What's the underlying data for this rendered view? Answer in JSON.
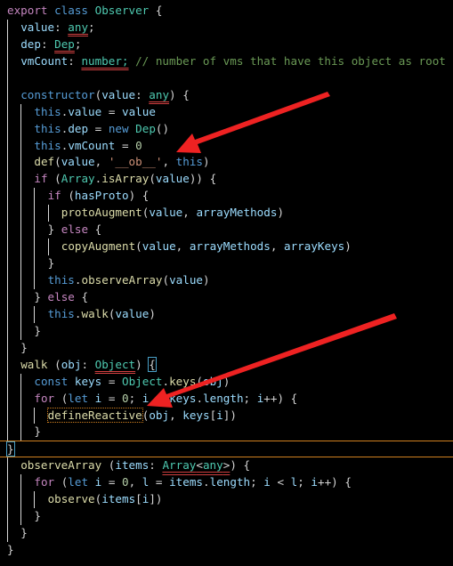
{
  "editor": {
    "theme_colors": {
      "background": "#000000",
      "keyword": "#c586c0",
      "storage": "#569cd6",
      "type": "#4ec9b0",
      "variable": "#9cdcfe",
      "function": "#dcdcaa",
      "string": "#ce9178",
      "comment": "#6a9955",
      "number": "#b5cea8",
      "annotation_arrow": "#ee2222"
    },
    "lines": [
      {
        "indent": 0,
        "tokens": [
          [
            "export",
            "kw"
          ],
          [
            " ",
            "p"
          ],
          [
            "class",
            "st"
          ],
          [
            " ",
            "p"
          ],
          [
            "Observer",
            "ty"
          ],
          [
            " {",
            "p"
          ]
        ]
      },
      {
        "indent": 1,
        "tokens": [
          [
            "value",
            "va"
          ],
          [
            ": ",
            "p"
          ],
          [
            "any",
            "ty err"
          ],
          [
            ";",
            "p"
          ]
        ]
      },
      {
        "indent": 1,
        "tokens": [
          [
            "dep",
            "va"
          ],
          [
            ": ",
            "p"
          ],
          [
            "Dep",
            "ty err"
          ],
          [
            ";",
            "p"
          ]
        ]
      },
      {
        "indent": 1,
        "tokens": [
          [
            "vmCount",
            "va"
          ],
          [
            ": ",
            "p"
          ],
          [
            "number;",
            "ty err"
          ],
          [
            " // number of vms that have this object as root",
            "cm"
          ]
        ]
      },
      {
        "indent": 1,
        "tokens": []
      },
      {
        "indent": 1,
        "tokens": [
          [
            "constructor",
            "st"
          ],
          [
            "(",
            "p"
          ],
          [
            "value",
            "va"
          ],
          [
            ": ",
            "p"
          ],
          [
            "any",
            "ty err"
          ],
          [
            ") {",
            "p"
          ]
        ]
      },
      {
        "indent": 2,
        "tokens": [
          [
            "this",
            "st"
          ],
          [
            ".",
            "p"
          ],
          [
            "value",
            "va"
          ],
          [
            " = ",
            "p"
          ],
          [
            "value",
            "va"
          ]
        ]
      },
      {
        "indent": 2,
        "tokens": [
          [
            "this",
            "st"
          ],
          [
            ".",
            "p"
          ],
          [
            "dep",
            "va"
          ],
          [
            " = ",
            "p"
          ],
          [
            "new",
            "st"
          ],
          [
            " ",
            "p"
          ],
          [
            "Dep",
            "ty"
          ],
          [
            "()",
            "p"
          ]
        ]
      },
      {
        "indent": 2,
        "tokens": [
          [
            "this",
            "st"
          ],
          [
            ".",
            "p"
          ],
          [
            "vmCount",
            "va"
          ],
          [
            " = ",
            "p"
          ],
          [
            "0",
            "num"
          ]
        ]
      },
      {
        "indent": 2,
        "tokens": [
          [
            "def",
            "fn"
          ],
          [
            "(",
            "p"
          ],
          [
            "value",
            "va"
          ],
          [
            ", ",
            "p"
          ],
          [
            "'__ob__'",
            "str"
          ],
          [
            ", ",
            "p"
          ],
          [
            "this",
            "st"
          ],
          [
            ")",
            "p"
          ]
        ]
      },
      {
        "indent": 2,
        "tokens": [
          [
            "if",
            "kw"
          ],
          [
            " (",
            "p"
          ],
          [
            "Array",
            "ty"
          ],
          [
            ".",
            "p"
          ],
          [
            "isArray",
            "fn"
          ],
          [
            "(",
            "p"
          ],
          [
            "value",
            "va"
          ],
          [
            ")) {",
            "p"
          ]
        ]
      },
      {
        "indent": 3,
        "tokens": [
          [
            "if",
            "kw"
          ],
          [
            " (",
            "p"
          ],
          [
            "hasProto",
            "va"
          ],
          [
            ") {",
            "p"
          ]
        ]
      },
      {
        "indent": 4,
        "tokens": [
          [
            "protoAugment",
            "fn"
          ],
          [
            "(",
            "p"
          ],
          [
            "value",
            "va"
          ],
          [
            ", ",
            "p"
          ],
          [
            "arrayMethods",
            "va"
          ],
          [
            ")",
            "p"
          ]
        ]
      },
      {
        "indent": 3,
        "tokens": [
          [
            "} ",
            "p"
          ],
          [
            "else",
            "kw"
          ],
          [
            " {",
            "p"
          ]
        ]
      },
      {
        "indent": 4,
        "tokens": [
          [
            "copyAugment",
            "fn"
          ],
          [
            "(",
            "p"
          ],
          [
            "value",
            "va"
          ],
          [
            ", ",
            "p"
          ],
          [
            "arrayMethods",
            "va"
          ],
          [
            ", ",
            "p"
          ],
          [
            "arrayKeys",
            "va"
          ],
          [
            ")",
            "p"
          ]
        ]
      },
      {
        "indent": 3,
        "tokens": [
          [
            "}",
            "p"
          ]
        ]
      },
      {
        "indent": 3,
        "tokens": [
          [
            "this",
            "st"
          ],
          [
            ".",
            "p"
          ],
          [
            "observeArray",
            "fn"
          ],
          [
            "(",
            "p"
          ],
          [
            "value",
            "va"
          ],
          [
            ")",
            "p"
          ]
        ]
      },
      {
        "indent": 2,
        "tokens": [
          [
            "} ",
            "p"
          ],
          [
            "else",
            "kw"
          ],
          [
            " {",
            "p"
          ]
        ]
      },
      {
        "indent": 3,
        "tokens": [
          [
            "this",
            "st"
          ],
          [
            ".",
            "p"
          ],
          [
            "walk",
            "fn"
          ],
          [
            "(",
            "p"
          ],
          [
            "value",
            "va"
          ],
          [
            ")",
            "p"
          ]
        ]
      },
      {
        "indent": 2,
        "tokens": [
          [
            "}",
            "p"
          ]
        ]
      },
      {
        "indent": 1,
        "tokens": [
          [
            "}",
            "p"
          ]
        ]
      },
      {
        "indent": 1,
        "tokens": [
          [
            "walk",
            "fn"
          ],
          [
            " (",
            "p"
          ],
          [
            "obj",
            "va"
          ],
          [
            ": ",
            "p"
          ],
          [
            "Object",
            "ty err"
          ],
          [
            ") ",
            "p"
          ],
          [
            "{",
            "p box"
          ]
        ]
      },
      {
        "indent": 2,
        "tokens": [
          [
            "const",
            "st"
          ],
          [
            " ",
            "p"
          ],
          [
            "keys",
            "va"
          ],
          [
            " = ",
            "p"
          ],
          [
            "Object",
            "ty"
          ],
          [
            ".",
            "p"
          ],
          [
            "keys",
            "fn"
          ],
          [
            "(",
            "p"
          ],
          [
            "obj",
            "va"
          ],
          [
            ")",
            "p"
          ]
        ]
      },
      {
        "indent": 2,
        "tokens": [
          [
            "for",
            "kw"
          ],
          [
            " (",
            "p"
          ],
          [
            "let",
            "st"
          ],
          [
            " ",
            "p"
          ],
          [
            "i",
            "va"
          ],
          [
            " = ",
            "p"
          ],
          [
            "0",
            "num"
          ],
          [
            "; ",
            "p"
          ],
          [
            "i",
            "va"
          ],
          [
            " < ",
            "p"
          ],
          [
            "keys",
            "va"
          ],
          [
            ".",
            "p"
          ],
          [
            "length",
            "va"
          ],
          [
            "; ",
            "p"
          ],
          [
            "i",
            "va"
          ],
          [
            "++) {",
            "p"
          ]
        ]
      },
      {
        "indent": 3,
        "tokens": [
          [
            "defineReactive",
            "fn dot"
          ],
          [
            "(",
            "p"
          ],
          [
            "obj",
            "va"
          ],
          [
            ", ",
            "p"
          ],
          [
            "keys",
            "va"
          ],
          [
            "[",
            "p"
          ],
          [
            "i",
            "va"
          ],
          [
            "])",
            "p"
          ]
        ]
      },
      {
        "indent": 2,
        "tokens": [
          [
            "}",
            "p"
          ]
        ]
      },
      {
        "indent": 0,
        "current": true,
        "tokens": [
          [
            "}",
            "p box"
          ]
        ]
      },
      {
        "indent": 1,
        "tokens": [
          [
            "observeArray",
            "fn"
          ],
          [
            " (",
            "p"
          ],
          [
            "items",
            "va"
          ],
          [
            ": ",
            "p"
          ],
          [
            "Array",
            "ty err"
          ],
          [
            "<",
            "p err"
          ],
          [
            "any",
            "ty err"
          ],
          [
            ">",
            "p err"
          ],
          [
            ") {",
            "p"
          ]
        ]
      },
      {
        "indent": 2,
        "tokens": [
          [
            "for",
            "kw"
          ],
          [
            " (",
            "p"
          ],
          [
            "let",
            "st"
          ],
          [
            " ",
            "p"
          ],
          [
            "i",
            "va"
          ],
          [
            " = ",
            "p"
          ],
          [
            "0",
            "num"
          ],
          [
            ", ",
            "p"
          ],
          [
            "l",
            "va"
          ],
          [
            " = ",
            "p"
          ],
          [
            "items",
            "va"
          ],
          [
            ".",
            "p"
          ],
          [
            "length",
            "va"
          ],
          [
            "; ",
            "p"
          ],
          [
            "i",
            "va"
          ],
          [
            " < ",
            "p"
          ],
          [
            "l",
            "va"
          ],
          [
            "; ",
            "p"
          ],
          [
            "i",
            "va"
          ],
          [
            "++) {",
            "p"
          ]
        ]
      },
      {
        "indent": 3,
        "tokens": [
          [
            "observe",
            "fn"
          ],
          [
            "(",
            "p"
          ],
          [
            "items",
            "va"
          ],
          [
            "[",
            "p"
          ],
          [
            "i",
            "va"
          ],
          [
            "])",
            "p"
          ]
        ]
      },
      {
        "indent": 2,
        "tokens": [
          [
            "}",
            "p"
          ]
        ]
      },
      {
        "indent": 1,
        "tokens": [
          [
            "}",
            "p"
          ]
        ]
      },
      {
        "indent": 0,
        "tokens": [
          [
            "}",
            "p"
          ]
        ]
      }
    ]
  },
  "annotations": [
    {
      "icon": "red-arrow-icon",
      "points_to": "def(value, '__ob__', this)"
    },
    {
      "icon": "red-arrow-icon",
      "points_to": "defineReactive(obj, keys[i])"
    }
  ]
}
